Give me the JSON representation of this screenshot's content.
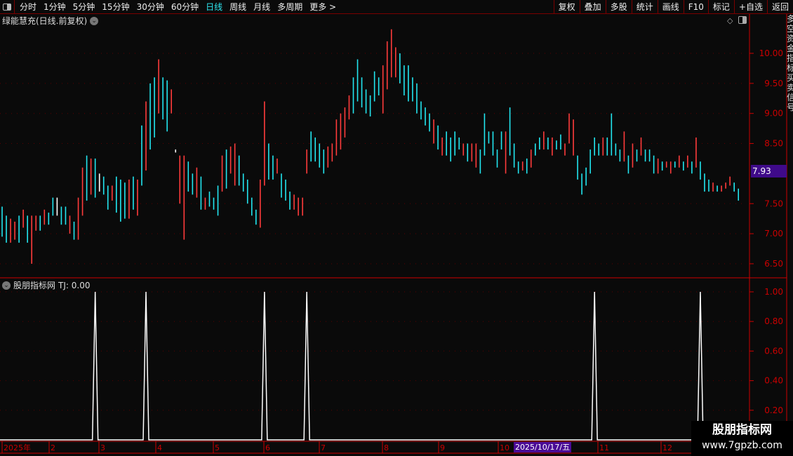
{
  "toolbar": {
    "periods": [
      "分时",
      "1分钟",
      "5分钟",
      "15分钟",
      "30分钟",
      "60分钟",
      "日线",
      "周线",
      "月线",
      "多周期",
      "更多 >"
    ],
    "active_period": "日线",
    "right_buttons": [
      "复权",
      "叠加",
      "多股",
      "统计",
      "画线",
      "F10",
      "标记",
      "+自选",
      "返回"
    ]
  },
  "main_panel": {
    "title": "绿能慧充(日线.前复权)",
    "current_price": "7.93"
  },
  "indicator_panel": {
    "title": "股朋指标网",
    "value_label": "TJ: 0.00"
  },
  "side_strip": "多空资金指标买卖信号",
  "watermark": {
    "name": "股朋指标网",
    "url": "www.7gpzb.com"
  },
  "selected_date": "2025/10/17/五",
  "colors": {
    "up": "#ff3b3b",
    "down": "#22e6f0",
    "axis": "#cc0000",
    "grid": "#5a0000",
    "signal": "#ffffff",
    "price_tag": "#3f0a8a"
  },
  "chart_data": [
    {
      "type": "ohlc-bar",
      "title": "绿能慧充(日线.前复权)",
      "y_ticks": [
        "10.00",
        "9.50",
        "9.00",
        "8.50",
        "7.50",
        "7.00",
        "6.50"
      ],
      "ylim": [
        6.35,
        10.45
      ],
      "x_ticks": [
        "2025年",
        "2",
        "3",
        "4",
        "5",
        "6",
        "7",
        "8",
        "9",
        "10",
        "11",
        "12",
        "1"
      ],
      "bars": [
        [
          6.95,
          7.45,
          "c"
        ],
        [
          6.85,
          7.3,
          "c"
        ],
        [
          6.85,
          7.25,
          "r"
        ],
        [
          6.9,
          7.2,
          "r"
        ],
        [
          6.85,
          7.3,
          "c"
        ],
        [
          7.1,
          7.4,
          "r"
        ],
        [
          6.85,
          7.3,
          "c"
        ],
        [
          6.5,
          7.3,
          "r"
        ],
        [
          7.05,
          7.3,
          "r"
        ],
        [
          7.05,
          7.3,
          "c"
        ],
        [
          7.15,
          7.4,
          "r"
        ],
        [
          7.15,
          7.35,
          "c"
        ],
        [
          7.3,
          7.6,
          "c"
        ],
        [
          7.3,
          7.6,
          "w"
        ],
        [
          7.15,
          7.45,
          "c"
        ],
        [
          7.15,
          7.45,
          "c"
        ],
        [
          7.0,
          7.3,
          "r"
        ],
        [
          6.9,
          7.2,
          "c"
        ],
        [
          6.9,
          7.6,
          "r"
        ],
        [
          7.3,
          8.1,
          "r"
        ],
        [
          7.55,
          8.3,
          "c"
        ],
        [
          7.65,
          8.25,
          "r"
        ],
        [
          7.6,
          8.25,
          "c"
        ],
        [
          7.7,
          8.0,
          "w"
        ],
        [
          7.65,
          7.95,
          "c"
        ],
        [
          7.4,
          7.8,
          "c"
        ],
        [
          7.55,
          7.8,
          "r"
        ],
        [
          7.35,
          7.95,
          "c"
        ],
        [
          7.2,
          7.9,
          "c"
        ],
        [
          7.25,
          7.85,
          "c"
        ],
        [
          7.25,
          7.9,
          "r"
        ],
        [
          7.4,
          7.95,
          "c"
        ],
        [
          7.3,
          7.9,
          "r"
        ],
        [
          7.8,
          8.8,
          "c"
        ],
        [
          8.05,
          9.2,
          "r"
        ],
        [
          8.4,
          9.5,
          "c"
        ],
        [
          8.6,
          9.6,
          "c"
        ],
        [
          9.0,
          9.9,
          "r"
        ],
        [
          8.9,
          9.6,
          "c"
        ],
        [
          8.7,
          9.55,
          "c"
        ],
        [
          9.0,
          9.4,
          "r"
        ],
        [
          8.35,
          8.4,
          "w"
        ],
        [
          7.5,
          8.3,
          "r"
        ],
        [
          6.9,
          8.3,
          "r"
        ],
        [
          7.7,
          8.2,
          "c"
        ],
        [
          7.65,
          8.0,
          "c"
        ],
        [
          7.6,
          8.1,
          "r"
        ],
        [
          7.4,
          7.95,
          "c"
        ],
        [
          7.4,
          7.6,
          "r"
        ],
        [
          7.45,
          7.7,
          "c"
        ],
        [
          7.4,
          7.6,
          "c"
        ],
        [
          7.3,
          7.8,
          "c"
        ],
        [
          7.7,
          8.3,
          "r"
        ],
        [
          7.75,
          8.4,
          "c"
        ],
        [
          8.0,
          8.45,
          "r"
        ],
        [
          7.8,
          8.5,
          "r"
        ],
        [
          7.8,
          8.3,
          "c"
        ],
        [
          7.7,
          8.0,
          "c"
        ],
        [
          7.5,
          7.9,
          "c"
        ],
        [
          7.3,
          7.6,
          "c"
        ],
        [
          7.15,
          7.4,
          "c"
        ],
        [
          7.1,
          7.9,
          "r"
        ],
        [
          7.8,
          9.2,
          "r"
        ],
        [
          7.9,
          8.5,
          "c"
        ],
        [
          7.9,
          8.3,
          "c"
        ],
        [
          8.0,
          8.25,
          "r"
        ],
        [
          7.6,
          8.0,
          "c"
        ],
        [
          7.55,
          7.9,
          "c"
        ],
        [
          7.4,
          7.7,
          "c"
        ],
        [
          7.4,
          7.65,
          "r"
        ],
        [
          7.3,
          7.6,
          "r"
        ],
        [
          7.3,
          7.6,
          "r"
        ],
        [
          8.0,
          8.4,
          "r"
        ],
        [
          8.2,
          8.7,
          "c"
        ],
        [
          8.2,
          8.6,
          "c"
        ],
        [
          8.1,
          8.5,
          "c"
        ],
        [
          8.0,
          8.4,
          "c"
        ],
        [
          8.1,
          8.45,
          "r"
        ],
        [
          8.2,
          8.5,
          "r"
        ],
        [
          8.3,
          8.9,
          "r"
        ],
        [
          8.4,
          9.0,
          "r"
        ],
        [
          8.6,
          9.1,
          "r"
        ],
        [
          8.9,
          9.3,
          "r"
        ],
        [
          9.0,
          9.6,
          "c"
        ],
        [
          9.2,
          9.9,
          "c"
        ],
        [
          9.1,
          9.6,
          "c"
        ],
        [
          9.0,
          9.4,
          "c"
        ],
        [
          8.95,
          9.3,
          "c"
        ],
        [
          9.2,
          9.7,
          "c"
        ],
        [
          9.3,
          9.6,
          "c"
        ],
        [
          9.0,
          9.8,
          "r"
        ],
        [
          9.4,
          10.2,
          "r"
        ],
        [
          9.6,
          10.4,
          "r"
        ],
        [
          9.6,
          10.1,
          "r"
        ],
        [
          9.5,
          10.0,
          "c"
        ],
        [
          9.3,
          9.8,
          "c"
        ],
        [
          9.2,
          9.8,
          "c"
        ],
        [
          9.2,
          9.6,
          "c"
        ],
        [
          9.0,
          9.5,
          "c"
        ],
        [
          8.9,
          9.2,
          "c"
        ],
        [
          8.8,
          9.1,
          "c"
        ],
        [
          8.7,
          9.0,
          "c"
        ],
        [
          8.5,
          8.9,
          "r"
        ],
        [
          8.4,
          8.8,
          "c"
        ],
        [
          8.3,
          8.6,
          "r"
        ],
        [
          8.3,
          8.7,
          "c"
        ],
        [
          8.2,
          8.6,
          "c"
        ],
        [
          8.3,
          8.7,
          "c"
        ],
        [
          8.4,
          8.6,
          "c"
        ],
        [
          8.3,
          8.5,
          "r"
        ],
        [
          8.2,
          8.5,
          "c"
        ],
        [
          8.2,
          8.5,
          "r"
        ],
        [
          8.1,
          8.5,
          "r"
        ],
        [
          8.0,
          8.4,
          "c"
        ],
        [
          8.3,
          9.0,
          "c"
        ],
        [
          8.5,
          8.7,
          "c"
        ],
        [
          8.3,
          8.7,
          "c"
        ],
        [
          8.1,
          8.4,
          "c"
        ],
        [
          8.4,
          8.7,
          "c"
        ],
        [
          8.0,
          8.7,
          "r"
        ],
        [
          8.3,
          9.1,
          "c"
        ],
        [
          8.1,
          8.5,
          "c"
        ],
        [
          8.0,
          8.2,
          "c"
        ],
        [
          8.05,
          8.2,
          "r"
        ],
        [
          8.0,
          8.25,
          "c"
        ],
        [
          8.1,
          8.4,
          "r"
        ],
        [
          8.3,
          8.5,
          "c"
        ],
        [
          8.4,
          8.6,
          "c"
        ],
        [
          8.4,
          8.7,
          "r"
        ],
        [
          8.4,
          8.6,
          "c"
        ],
        [
          8.3,
          8.6,
          "r"
        ],
        [
          8.4,
          8.55,
          "c"
        ],
        [
          8.4,
          8.65,
          "c"
        ],
        [
          8.3,
          8.5,
          "r"
        ],
        [
          8.5,
          9.0,
          "r"
        ],
        [
          8.3,
          8.9,
          "r"
        ],
        [
          7.9,
          8.3,
          "c"
        ],
        [
          7.65,
          8.0,
          "c"
        ],
        [
          7.8,
          8.1,
          "c"
        ],
        [
          8.0,
          8.4,
          "c"
        ],
        [
          8.3,
          8.6,
          "c"
        ],
        [
          8.3,
          8.5,
          "c"
        ],
        [
          8.3,
          8.6,
          "r"
        ],
        [
          8.3,
          8.6,
          "c"
        ],
        [
          8.3,
          9.0,
          "c"
        ],
        [
          8.3,
          8.5,
          "c"
        ],
        [
          8.2,
          8.4,
          "c"
        ],
        [
          8.2,
          8.7,
          "r"
        ],
        [
          8.0,
          8.3,
          "c"
        ],
        [
          8.1,
          8.5,
          "r"
        ],
        [
          8.2,
          8.4,
          "c"
        ],
        [
          8.3,
          8.6,
          "r"
        ],
        [
          8.2,
          8.4,
          "c"
        ],
        [
          8.2,
          8.4,
          "c"
        ],
        [
          8.0,
          8.3,
          "c"
        ],
        [
          8.0,
          8.25,
          "r"
        ],
        [
          8.05,
          8.2,
          "c"
        ],
        [
          8.1,
          8.2,
          "r"
        ],
        [
          8.0,
          8.2,
          "r"
        ],
        [
          8.1,
          8.2,
          "c"
        ],
        [
          8.1,
          8.3,
          "r"
        ],
        [
          8.05,
          8.2,
          "c"
        ],
        [
          8.1,
          8.3,
          "r"
        ],
        [
          8.0,
          8.2,
          "c"
        ],
        [
          8.1,
          8.6,
          "r"
        ],
        [
          7.9,
          8.2,
          "c"
        ],
        [
          7.7,
          8.0,
          "c"
        ],
        [
          7.7,
          7.9,
          "c"
        ],
        [
          7.7,
          7.85,
          "r"
        ],
        [
          7.7,
          7.8,
          "c"
        ],
        [
          7.7,
          7.8,
          "r"
        ],
        [
          7.75,
          7.85,
          "r"
        ],
        [
          7.8,
          7.95,
          "r"
        ],
        [
          7.7,
          7.85,
          "c"
        ],
        [
          7.55,
          7.75,
          "c"
        ]
      ]
    },
    {
      "type": "line",
      "title": "股朋指标网",
      "series_name": "TJ",
      "y_ticks": [
        "1.00",
        "0.80",
        "0.60",
        "0.40",
        "0.20"
      ],
      "ylim": [
        0,
        1
      ],
      "signal_bars": [
        22,
        34,
        62,
        72,
        140,
        165
      ],
      "signal_value": 1
    }
  ]
}
